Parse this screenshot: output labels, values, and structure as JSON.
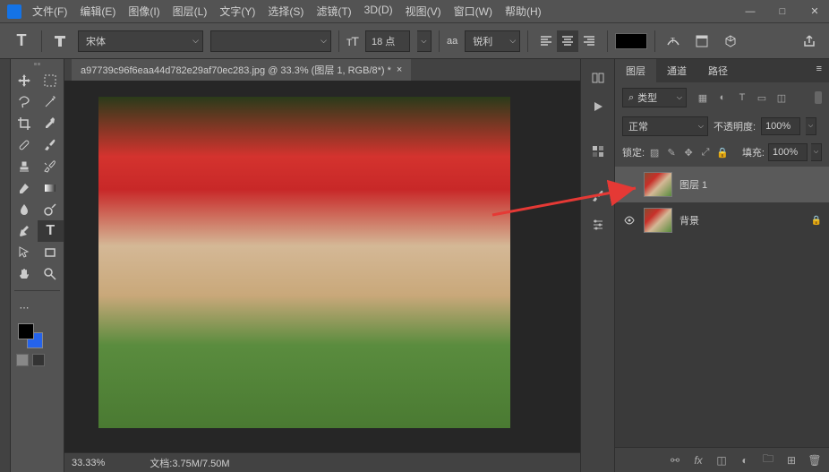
{
  "menubar": {
    "items": [
      "文件(F)",
      "编辑(E)",
      "图像(I)",
      "图层(L)",
      "文字(Y)",
      "选择(S)",
      "滤镜(T)",
      "3D(D)",
      "视图(V)",
      "窗口(W)",
      "帮助(H)"
    ]
  },
  "options": {
    "tool_glyph": "T",
    "font_family": "宋体",
    "font_style": "",
    "font_size": "18 点",
    "aa_label": "aa",
    "aa_mode": "锐利"
  },
  "document": {
    "tab_title": "a97739c96f6eaa44d782e29af70ec283.jpg @ 33.3% (图层 1, RGB/8*) *",
    "zoom": "33.33%",
    "doc_info_label": "文档:",
    "doc_info_value": "3.75M/7.50M"
  },
  "panels": {
    "tabs": [
      "图层",
      "通道",
      "路径"
    ],
    "filter_label": "类型",
    "blend_mode": "正常",
    "opacity_label": "不透明度:",
    "opacity_value": "100%",
    "lock_label": "锁定:",
    "fill_label": "填充:",
    "fill_value": "100%"
  },
  "layers": [
    {
      "name": "图层 1",
      "visible": false,
      "locked": false,
      "selected": true
    },
    {
      "name": "背景",
      "visible": true,
      "locked": true,
      "selected": false
    }
  ],
  "colors": {
    "foreground": "#000000",
    "background": "#2563eb",
    "text_swatch": "#000000"
  }
}
